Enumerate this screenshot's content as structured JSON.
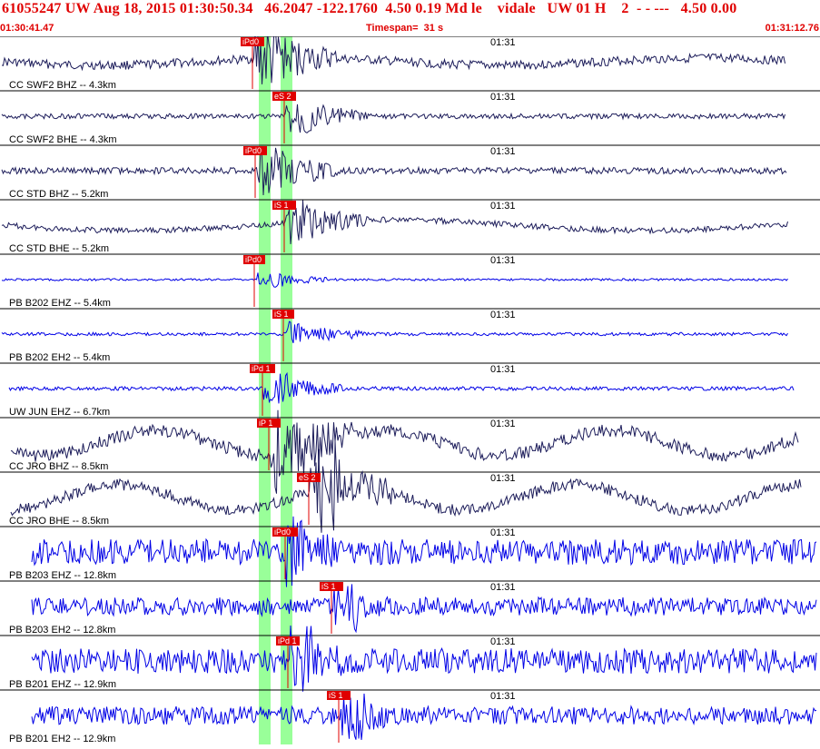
{
  "header": {
    "title": "61055247 UW Aug 18, 2015 01:30:50.34   46.2047 -122.1760  4.50 0.19 Md le    vidale   UW 01 H    2  - - ---   4.50 0.00",
    "start_time": "01:30:41.47",
    "timespan": "Timespan=  31 s",
    "end_time": "01:31:12.76"
  },
  "colors": {
    "header": "#e00000",
    "trace_dark": "#1c1c5a",
    "trace_blue": "#0000e6",
    "pick_band": "#99ff99",
    "pick_label_bg": "#e00000",
    "pick_line": "#e00000",
    "divider": "#000000"
  },
  "traces": [
    {
      "label": "CC SWF2 BHZ -- 4.3km",
      "minute": "01:31",
      "pick": "iPd0"
    },
    {
      "label": "CC SWF2 BHE -- 4.3km",
      "minute": "01:31",
      "pick": "eS 2"
    },
    {
      "label": "CC STD BHZ -- 5.2km",
      "minute": "01:31",
      "pick": "iPd0"
    },
    {
      "label": "CC STD BHE -- 5.2km",
      "minute": "01:31",
      "pick": "iS 1"
    },
    {
      "label": "PB B202 EHZ -- 5.4km",
      "minute": "01:31",
      "pick": "iPd0"
    },
    {
      "label": "PB B202 EH2 -- 5.4km",
      "minute": "01:31",
      "pick": "iS 1"
    },
    {
      "label": "UW JUN EHZ -- 6.7km",
      "minute": "01:31",
      "pick": "iPd 1"
    },
    {
      "label": "CC JRO BHZ -- 8.5km",
      "minute": "01:31",
      "pick": "iP 1"
    },
    {
      "label": "CC JRO BHE -- 8.5km",
      "minute": "01:31",
      "pick": "eS 2"
    },
    {
      "label": "PB B203 EHZ -- 12.8km",
      "minute": "01:31",
      "pick": "iPd0"
    },
    {
      "label": "PB B203 EH2 -- 12.8km",
      "minute": "01:31",
      "pick": "iS 1"
    },
    {
      "label": "PB B201 EHZ -- 12.9km",
      "minute": "01:31",
      "pick": "iPd 1"
    },
    {
      "label": "PB B201 EH2 -- 12.9km",
      "minute": "01:31",
      "pick": "iS 1"
    }
  ]
}
